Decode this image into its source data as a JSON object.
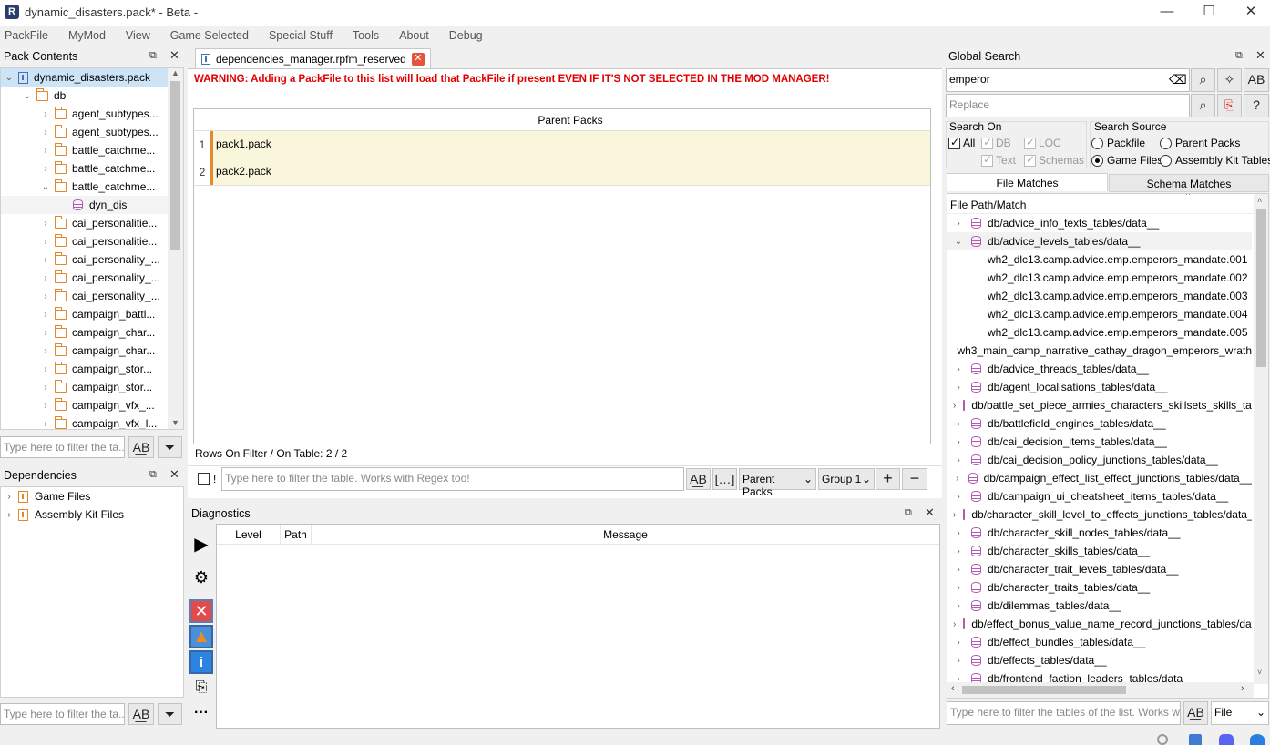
{
  "window": {
    "title": "dynamic_disasters.pack* - Beta -",
    "minimize": "—",
    "maximize": "☐",
    "close": "✕"
  },
  "menu": [
    "PackFile",
    "MyMod",
    "View",
    "Game Selected",
    "Special Stuff",
    "Tools",
    "About",
    "Debug"
  ],
  "pack_contents": {
    "title": "Pack Contents",
    "root": "dynamic_disasters.pack",
    "db": "db",
    "items": [
      {
        "label": "agent_subtypes...",
        "arrow": "›",
        "kind": "folder"
      },
      {
        "label": "agent_subtypes...",
        "arrow": "›",
        "kind": "folder"
      },
      {
        "label": "battle_catchme...",
        "arrow": "›",
        "kind": "folder"
      },
      {
        "label": "battle_catchme...",
        "arrow": "›",
        "kind": "folder"
      },
      {
        "label": "battle_catchme...",
        "arrow": "⌄",
        "kind": "folder"
      },
      {
        "label": "dyn_dis",
        "arrow": "",
        "kind": "db"
      },
      {
        "label": "cai_personalitie...",
        "arrow": "›",
        "kind": "folder"
      },
      {
        "label": "cai_personalitie...",
        "arrow": "›",
        "kind": "folder"
      },
      {
        "label": "cai_personality_...",
        "arrow": "›",
        "kind": "folder"
      },
      {
        "label": "cai_personality_...",
        "arrow": "›",
        "kind": "folder"
      },
      {
        "label": "cai_personality_...",
        "arrow": "›",
        "kind": "folder"
      },
      {
        "label": "campaign_battl...",
        "arrow": "›",
        "kind": "folder"
      },
      {
        "label": "campaign_char...",
        "arrow": "›",
        "kind": "folder"
      },
      {
        "label": "campaign_char...",
        "arrow": "›",
        "kind": "folder"
      },
      {
        "label": "campaign_stor...",
        "arrow": "›",
        "kind": "folder"
      },
      {
        "label": "campaign_stor...",
        "arrow": "›",
        "kind": "folder"
      },
      {
        "label": "campaign_vfx_...",
        "arrow": "›",
        "kind": "folder"
      },
      {
        "label": "campaign_vfx_l...",
        "arrow": "›",
        "kind": "folder"
      }
    ],
    "filter_placeholder": "Type here to filter the ta..."
  },
  "dependencies": {
    "title": "Dependencies",
    "items": [
      "Game Files",
      "Assembly Kit Files"
    ],
    "filter_placeholder": "Type here to filter the ta..."
  },
  "editor": {
    "tab_label": "dependencies_manager.rpfm_reserved",
    "warning": "WARNING: Adding a PackFile to this list will load that PackFile if present EVEN IF IT'S NOT SELECTED IN THE MOD MANAGER!",
    "column_header": "Parent Packs",
    "rows": [
      {
        "num": "1",
        "value": "pack1.pack"
      },
      {
        "num": "2",
        "value": "pack2.pack"
      }
    ],
    "rows_status": "Rows On Filter / On Table: 2 / 2",
    "not_label": "!",
    "filter_placeholder": "Type here to filter the table. Works with Regex too!",
    "column_combo": "Parent Packs",
    "group_combo": "Group 1"
  },
  "diagnostics": {
    "title": "Diagnostics",
    "columns": [
      "Level",
      "Path",
      "Message"
    ]
  },
  "global_search": {
    "title": "Global Search",
    "search_value": "emperor",
    "replace_placeholder": "Replace",
    "search_on_label": "Search On",
    "search_on": {
      "all": "All",
      "db": "DB",
      "loc": "LOC",
      "text": "Text",
      "schemas": "Schemas"
    },
    "search_source_label": "Search Source",
    "search_source": {
      "packfile": "Packfile",
      "parent_packs": "Parent Packs",
      "game_files": "Game Files",
      "assembly_kit": "Assembly Kit Tables"
    },
    "tabs": [
      "File Matches",
      "Schema Matches"
    ],
    "results_header": "File Path/Match",
    "results": [
      {
        "label": "db/advice_info_texts_tables/data__",
        "arrow": "›",
        "kind": "db"
      },
      {
        "label": "db/advice_levels_tables/data__",
        "arrow": "⌄",
        "kind": "db"
      },
      {
        "label": "wh2_dlc13.camp.advice.emp.emperors_mandate.001",
        "arrow": "",
        "kind": "match"
      },
      {
        "label": "wh2_dlc13.camp.advice.emp.emperors_mandate.002",
        "arrow": "",
        "kind": "match"
      },
      {
        "label": "wh2_dlc13.camp.advice.emp.emperors_mandate.003",
        "arrow": "",
        "kind": "match"
      },
      {
        "label": "wh2_dlc13.camp.advice.emp.emperors_mandate.004",
        "arrow": "",
        "kind": "match"
      },
      {
        "label": "wh2_dlc13.camp.advice.emp.emperors_mandate.005",
        "arrow": "",
        "kind": "match"
      },
      {
        "label": "wh3_main_camp_narrative_cathay_dragon_emperors_wrath",
        "arrow": "",
        "kind": "match"
      },
      {
        "label": "db/advice_threads_tables/data__",
        "arrow": "›",
        "kind": "db"
      },
      {
        "label": "db/agent_localisations_tables/data__",
        "arrow": "›",
        "kind": "db"
      },
      {
        "label": "db/battle_set_piece_armies_characters_skillsets_skills_table",
        "arrow": "›",
        "kind": "db"
      },
      {
        "label": "db/battlefield_engines_tables/data__",
        "arrow": "›",
        "kind": "db"
      },
      {
        "label": "db/cai_decision_items_tables/data__",
        "arrow": "›",
        "kind": "db"
      },
      {
        "label": "db/cai_decision_policy_junctions_tables/data__",
        "arrow": "›",
        "kind": "db"
      },
      {
        "label": "db/campaign_effect_list_effect_junctions_tables/data__",
        "arrow": "›",
        "kind": "db"
      },
      {
        "label": "db/campaign_ui_cheatsheet_items_tables/data__",
        "arrow": "›",
        "kind": "db"
      },
      {
        "label": "db/character_skill_level_to_effects_junctions_tables/data__",
        "arrow": "›",
        "kind": "db"
      },
      {
        "label": "db/character_skill_nodes_tables/data__",
        "arrow": "›",
        "kind": "db"
      },
      {
        "label": "db/character_skills_tables/data__",
        "arrow": "›",
        "kind": "db"
      },
      {
        "label": "db/character_trait_levels_tables/data__",
        "arrow": "›",
        "kind": "db"
      },
      {
        "label": "db/character_traits_tables/data__",
        "arrow": "›",
        "kind": "db"
      },
      {
        "label": "db/dilemmas_tables/data__",
        "arrow": "›",
        "kind": "db"
      },
      {
        "label": "db/effect_bonus_value_name_record_junctions_tables/data",
        "arrow": "›",
        "kind": "db"
      },
      {
        "label": "db/effect_bundles_tables/data__",
        "arrow": "›",
        "kind": "db"
      },
      {
        "label": "db/effects_tables/data__",
        "arrow": "›",
        "kind": "db"
      },
      {
        "label": "db/frontend_faction_leaders_tables/data",
        "arrow": "›",
        "kind": "db"
      }
    ],
    "filter_placeholder": "Type here to filter the tables of the list. Works wit...",
    "filter_combo": "File"
  }
}
